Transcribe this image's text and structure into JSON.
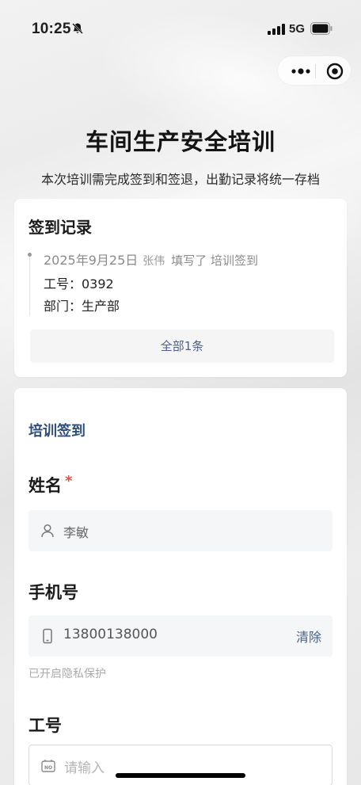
{
  "status_bar": {
    "time": "10:25",
    "network": "5G"
  },
  "header": {
    "title": "车间生产安全培训",
    "subtitle": "本次培训需完成签到和签退，出勤记录将统一存档"
  },
  "record_card": {
    "title": "签到记录",
    "entry": {
      "date": "2025年9月25日",
      "user": "张伟",
      "action": "填写了 培训签到",
      "line1": "工号：0392",
      "line2": "部门：生产部"
    },
    "view_all_label": "全部1条"
  },
  "form": {
    "section_title": "培训签到",
    "name": {
      "label": "姓名",
      "required_mark": "*",
      "value": "李敏"
    },
    "phone": {
      "label": "手机号",
      "value": "13800138000",
      "clear_label": "清除",
      "hint": "已开启隐私保护"
    },
    "employee_id": {
      "label": "工号",
      "placeholder": "请输入"
    }
  },
  "colors": {
    "accent": "#2f4f7b",
    "link": "#49618a",
    "required": "#d9534f"
  },
  "icons": [
    "bell-off-icon",
    "signal-icon",
    "battery-icon",
    "more-icon",
    "target-icon",
    "person-icon",
    "phone-icon",
    "id-card-icon"
  ]
}
